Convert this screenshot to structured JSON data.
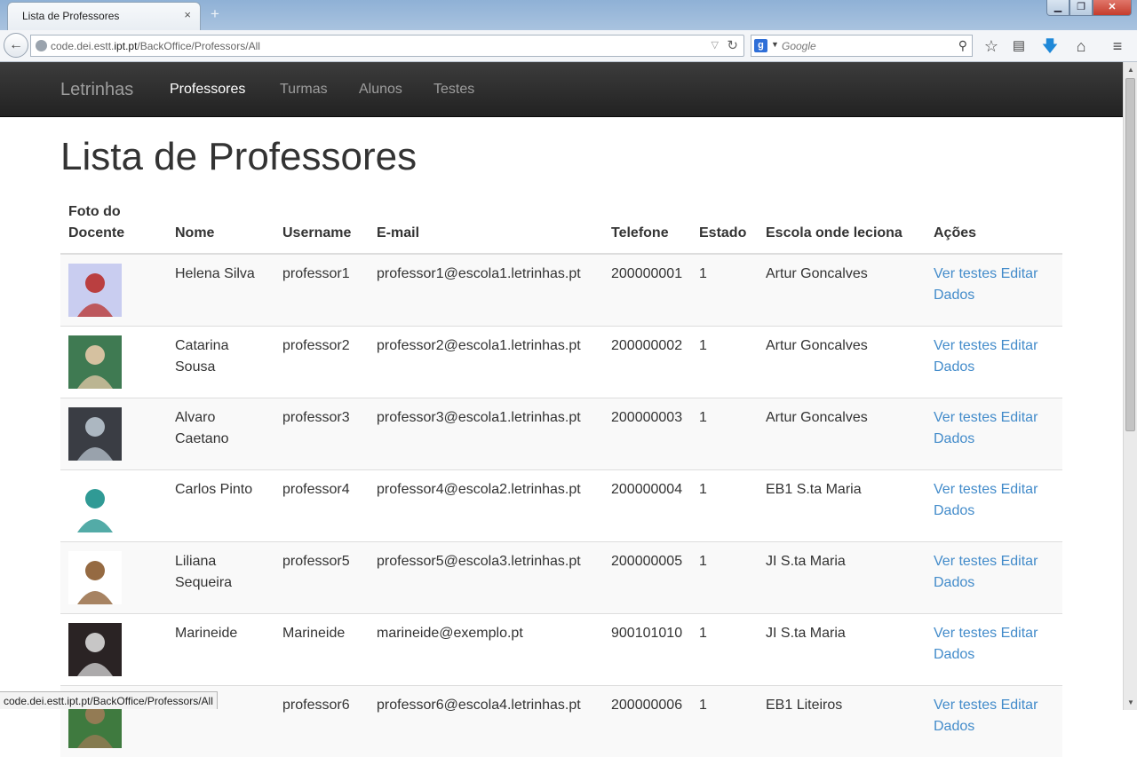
{
  "browser": {
    "tab_title": "Lista de Professores",
    "tab_close": "×",
    "new_tab": "+",
    "url_prefix": "code.dei.estt.",
    "url_domain": "ipt.pt",
    "url_path": "/BackOffice/Professors/All",
    "search_placeholder": "Google",
    "status_url": "code.dei.estt.ipt.pt/BackOffice/Professors/All",
    "window_min": "▁",
    "window_restore": "❐",
    "window_close": "✕"
  },
  "nav": {
    "brand": "Letrinhas",
    "items": [
      {
        "label": "Professores",
        "active": true
      },
      {
        "label": "Turmas",
        "active": false
      },
      {
        "label": "Alunos",
        "active": false
      },
      {
        "label": "Testes",
        "active": false
      }
    ]
  },
  "page": {
    "title": "Lista de Professores"
  },
  "table": {
    "headers": {
      "foto": "Foto do Docente",
      "nome": "Nome",
      "username": "Username",
      "email": "E-mail",
      "telefone": "Telefone",
      "estado": "Estado",
      "escola": "Escola onde leciona",
      "acoes": "Ações"
    },
    "action_ver": "Ver testes",
    "action_editar": "Editar Dados",
    "rows": [
      {
        "nome": "Helena Silva",
        "username": "professor1",
        "email": "professor1@escola1.letrinhas.pt",
        "telefone": "200000001",
        "estado": "1",
        "escola": "Artur Goncalves",
        "photo_bg": "#c9cdf0",
        "photo_fg": "#b8302c"
      },
      {
        "nome": "Catarina Sousa",
        "username": "professor2",
        "email": "professor2@escola1.letrinhas.pt",
        "telefone": "200000002",
        "estado": "1",
        "escola": "Artur Goncalves",
        "photo_bg": "#3f7a52",
        "photo_fg": "#e6c9a8"
      },
      {
        "nome": "Alvaro Caetano",
        "username": "professor3",
        "email": "professor3@escola1.letrinhas.pt",
        "telefone": "200000003",
        "estado": "1",
        "escola": "Artur Goncalves",
        "photo_bg": "#3a3d44",
        "photo_fg": "#b9c4cf"
      },
      {
        "nome": "Carlos Pinto",
        "username": "professor4",
        "email": "professor4@escola2.letrinhas.pt",
        "telefone": "200000004",
        "estado": "1",
        "escola": "EB1 S.ta Maria",
        "photo_bg": "#ffffff",
        "photo_fg": "#1a8f8a"
      },
      {
        "nome": "Liliana Sequeira",
        "username": "professor5",
        "email": "professor5@escola3.letrinhas.pt",
        "telefone": "200000005",
        "estado": "1",
        "escola": "JI S.ta Maria",
        "photo_bg": "#ffffff",
        "photo_fg": "#8a5a2e"
      },
      {
        "nome": "Marineide",
        "username": "Marineide",
        "email": "marineide@exemplo.pt",
        "telefone": "900101010",
        "estado": "1",
        "escola": "JI S.ta Maria",
        "photo_bg": "#2a2324",
        "photo_fg": "#d8d8d8"
      },
      {
        "nome": "Dias",
        "username": "professor6",
        "email": "professor6@escola4.letrinhas.pt",
        "telefone": "200000006",
        "estado": "1",
        "escola": "EB1 Liteiros",
        "photo_bg": "#3f7a3f",
        "photo_fg": "#9c7b56"
      }
    ]
  }
}
